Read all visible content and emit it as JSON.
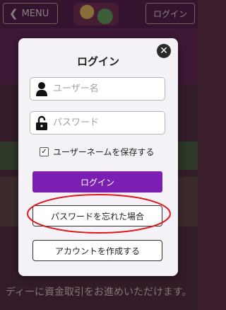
{
  "header": {
    "menu_label": "MENU",
    "login_label": "ログイン"
  },
  "background": {
    "footer_text": "ディーに資金取引をお進めいただけます。"
  },
  "modal": {
    "title": "ログイン",
    "username_placeholder": "ユーザー名",
    "password_placeholder": "パスワード",
    "remember_label": "ユーザーネームを保存する",
    "remember_checked": true,
    "login_button": "ログイン",
    "forgot_button": "パスワードを忘れた場合",
    "create_button": "アカウントを作成する"
  },
  "colors": {
    "primary_button": "#7a1fb2",
    "annotation": "#e0161b"
  }
}
